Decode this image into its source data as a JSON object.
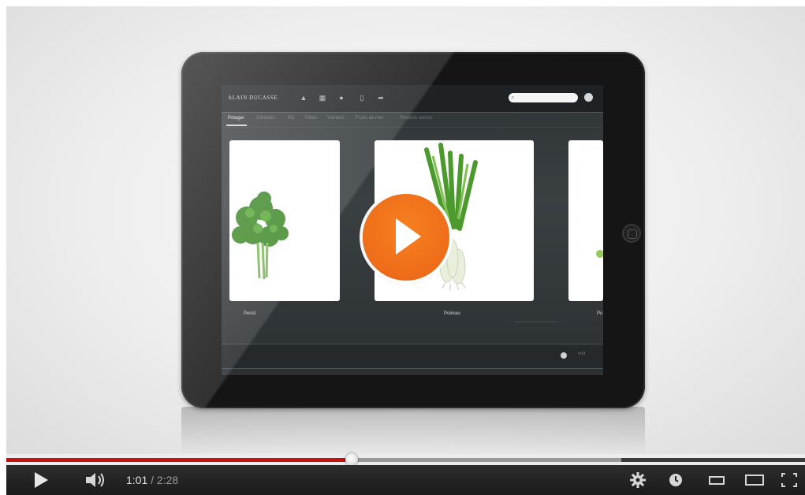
{
  "video": {
    "app": {
      "brand": "ALAIN DUCASSE",
      "categories": [
        {
          "label": "Potager",
          "active": true
        },
        {
          "label": "Céréales",
          "active": false
        },
        {
          "label": "Riz",
          "active": false
        },
        {
          "label": "Pâtes",
          "active": false
        },
        {
          "label": "Viandes",
          "active": false
        },
        {
          "label": "Fruits de mer",
          "active": false
        },
        {
          "label": "Produits sucrés",
          "active": false
        }
      ],
      "cards": [
        {
          "label": "Persil"
        },
        {
          "label": "Poireau"
        },
        {
          "label": "Po"
        }
      ],
      "bottom_text": "voir"
    }
  },
  "player": {
    "current_time": "1:01",
    "separator": " / ",
    "duration": "2:28",
    "played_fraction": 0.4325,
    "buffered_fraction": 0.77,
    "colors": {
      "played": "#c4120f",
      "buffered": "#9a9a9a",
      "play_button": "#ef6d1a"
    },
    "icons": [
      "play-icon",
      "volume-icon",
      "settings-icon",
      "watch-later-icon",
      "small-player-icon",
      "large-player-icon",
      "fullscreen-icon"
    ]
  }
}
